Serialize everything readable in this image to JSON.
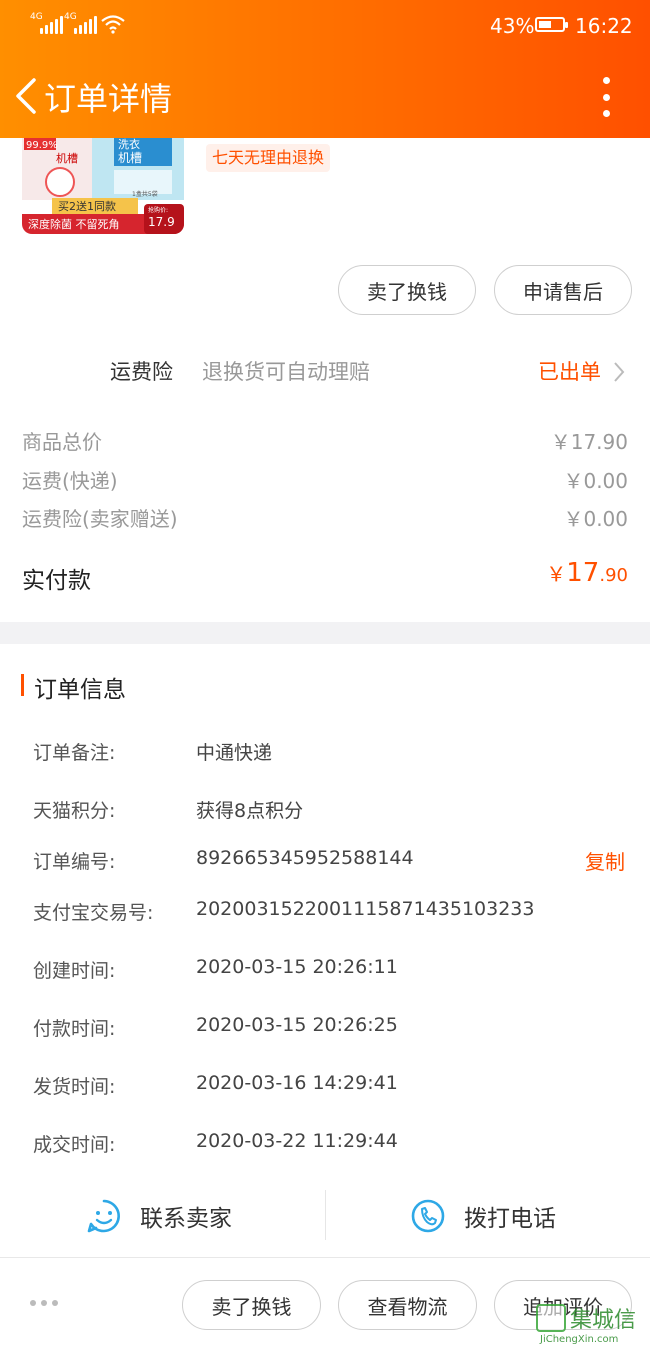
{
  "status_bar": {
    "net1": "4G",
    "net2": "4G",
    "battery_pct": "43%",
    "time": "16:22"
  },
  "header": {
    "title": "订单详情"
  },
  "product": {
    "thumb_lines": [
      "99.9%",
      "机槽",
      "洗衣",
      "机槽",
      "1盒共5袋",
      "买2送1同款",
      "深度除菌 不留死角",
      "抢购价:",
      "17.9"
    ],
    "tag": "七天无理由退换",
    "buttons": [
      "卖了换钱",
      "申请售后"
    ]
  },
  "insurance": {
    "label": "运费险",
    "desc": "退换货可自动理赔",
    "status": "已出单"
  },
  "fees": [
    {
      "label": "商品总价",
      "value": "￥17.90"
    },
    {
      "label": "运费(快递)",
      "value": "￥0.00"
    },
    {
      "label": "运费险(卖家赠送)",
      "value": "￥0.00"
    }
  ],
  "paid": {
    "label": "实付款",
    "currency": "￥",
    "int": "17",
    "dec": ".90"
  },
  "order_info": {
    "title": "订单信息",
    "rows": [
      {
        "label": "订单备注:",
        "value": "中通快递"
      },
      {
        "label": "天猫积分:",
        "value": "获得8点积分"
      },
      {
        "label": "订单编号:",
        "value": "892665345952588144"
      },
      {
        "label": "支付宝交易号:",
        "value": "2020031522001115871435103233"
      },
      {
        "label": "创建时间:",
        "value": "2020-03-15 20:26:11"
      },
      {
        "label": "付款时间:",
        "value": "2020-03-15 20:26:25"
      },
      {
        "label": "发货时间:",
        "value": "2020-03-16 14:29:41"
      },
      {
        "label": "成交时间:",
        "value": "2020-03-22 11:29:44"
      }
    ],
    "copy_label": "复制"
  },
  "contact": {
    "seller": "联系卖家",
    "phone": "拨打电话"
  },
  "bottom_bar": {
    "buttons": [
      "卖了换钱",
      "查看物流",
      "追加评价"
    ]
  },
  "watermark": {
    "brand": "集城信",
    "url": "JiChengXin.com"
  },
  "colors": {
    "accent": "#ff5000",
    "header_start": "#ff8f00",
    "header_end": "#ff5000",
    "icon_blue": "#2ea8e6"
  }
}
